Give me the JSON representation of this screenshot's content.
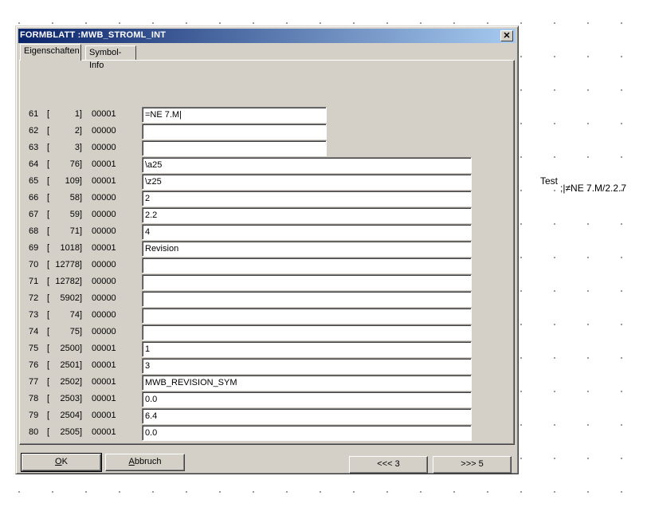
{
  "canvas": {
    "label_test": "Test",
    "label_value": ";|≠NE 7.M/2.2.7"
  },
  "window": {
    "title": "FORMBLATT :MWB_STROML_INT",
    "close_glyph": "✕"
  },
  "tabs": [
    {
      "label": "Eigenschaften",
      "active": true
    },
    {
      "label": "Symbol-Info",
      "active": false
    }
  ],
  "rows": [
    {
      "num": "61",
      "lb": "[",
      "id": "1]",
      "flag": "00001",
      "value": "=NE 7.M|"
    },
    {
      "num": "62",
      "lb": "[",
      "id": "2]",
      "flag": "00000",
      "value": ""
    },
    {
      "num": "63",
      "lb": "[",
      "id": "3]",
      "flag": "00000",
      "value": ""
    },
    {
      "num": "64",
      "lb": "[",
      "id": "76]",
      "flag": "00001",
      "value": "\\a25"
    },
    {
      "num": "65",
      "lb": "[",
      "id": "109]",
      "flag": "00001",
      "value": "\\z25"
    },
    {
      "num": "66",
      "lb": "[",
      "id": "58]",
      "flag": "00000",
      "value": "2"
    },
    {
      "num": "67",
      "lb": "[",
      "id": "59]",
      "flag": "00000",
      "value": "2.2"
    },
    {
      "num": "68",
      "lb": "[",
      "id": "71]",
      "flag": "00000",
      "value": "4"
    },
    {
      "num": "69",
      "lb": "[",
      "id": "1018]",
      "flag": "00001",
      "value": "Revision"
    },
    {
      "num": "70",
      "lb": "[",
      "id": "12778]",
      "flag": "00000",
      "value": ""
    },
    {
      "num": "71",
      "lb": "[",
      "id": "12782]",
      "flag": "00000",
      "value": ""
    },
    {
      "num": "72",
      "lb": "[",
      "id": "5902]",
      "flag": "00000",
      "value": ""
    },
    {
      "num": "73",
      "lb": "[",
      "id": "74]",
      "flag": "00000",
      "value": ""
    },
    {
      "num": "74",
      "lb": "[",
      "id": "75]",
      "flag": "00000",
      "value": ""
    },
    {
      "num": "75",
      "lb": "[",
      "id": "2500]",
      "flag": "00001",
      "value": "1"
    },
    {
      "num": "76",
      "lb": "[",
      "id": "2501]",
      "flag": "00001",
      "value": "3"
    },
    {
      "num": "77",
      "lb": "[",
      "id": "2502]",
      "flag": "00001",
      "value": "MWB_REVISION_SYM"
    },
    {
      "num": "78",
      "lb": "[",
      "id": "2503]",
      "flag": "00001",
      "value": "0.0"
    },
    {
      "num": "79",
      "lb": "[",
      "id": "2504]",
      "flag": "00001",
      "value": "6.4"
    },
    {
      "num": "80",
      "lb": "[",
      "id": "2505]",
      "flag": "00001",
      "value": "0.0"
    }
  ],
  "nav": {
    "prev_label": "<<< 3",
    "next_label": ">>> 5"
  },
  "footer": {
    "ok_hotkey": "O",
    "ok_rest": "K",
    "cancel_hotkey": "A",
    "cancel_rest": "bbruch"
  }
}
